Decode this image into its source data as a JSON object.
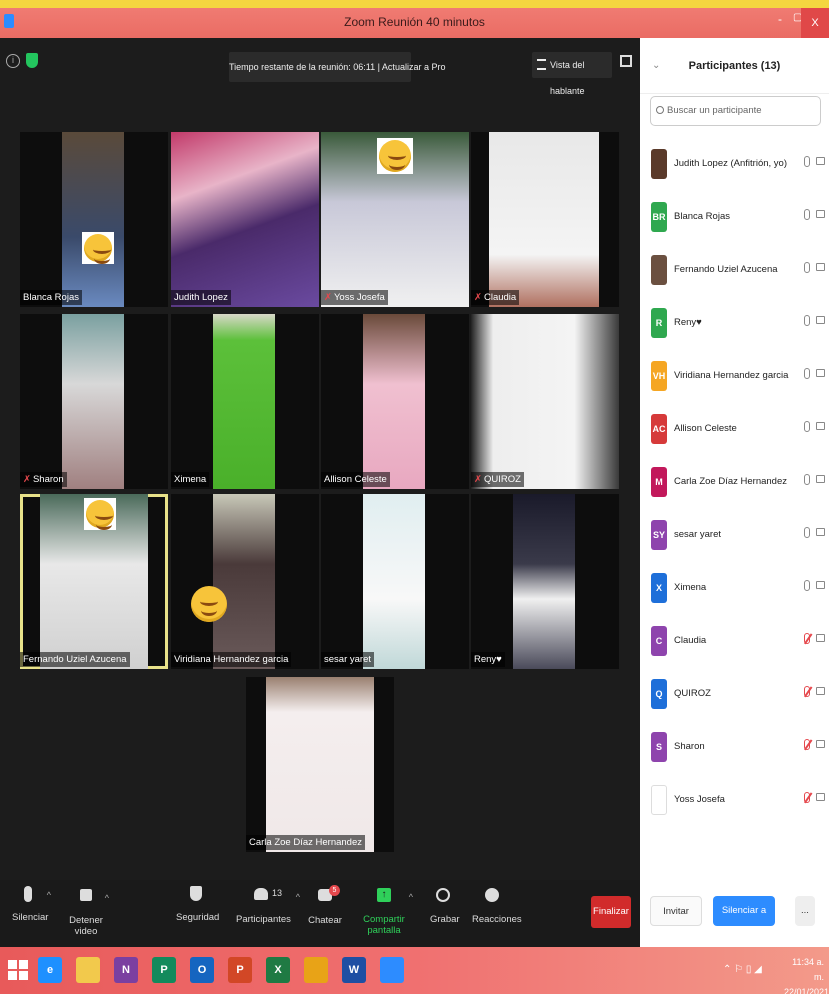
{
  "window": {
    "title": "Zoom Reunión 40 minutos",
    "minimize": "-",
    "maximize": "▢",
    "close": "X"
  },
  "meeting": {
    "time_banner": "Tiempo restante de la reunión: 06:11 | Actualizar a Pro",
    "speaker_view": "Vista del hablante",
    "info_symbol": "i"
  },
  "tiles": [
    {
      "name": "Blanca Rojas",
      "muted": false
    },
    {
      "name": "Judith Lopez",
      "muted": false
    },
    {
      "name": "Yoss Josefa",
      "muted": true
    },
    {
      "name": "Claudia",
      "muted": true
    },
    {
      "name": "Sharon",
      "muted": true
    },
    {
      "name": "Ximena",
      "muted": false
    },
    {
      "name": "Allison Celeste",
      "muted": false
    },
    {
      "name": "QUIROZ",
      "muted": true
    },
    {
      "name": "Fernando Uziel Azucena",
      "muted": false
    },
    {
      "name": "Viridiana Hernandez garcia",
      "muted": false
    },
    {
      "name": "sesar yaret",
      "muted": false
    },
    {
      "name": "Reny♥",
      "muted": false
    },
    {
      "name": "Carla Zoe Díaz Hernandez",
      "muted": false
    }
  ],
  "toolbar": {
    "mute": "Silenciar",
    "stop_video": "Detener video",
    "security": "Seguridad",
    "participants": "Participantes",
    "participants_count": "13",
    "chat": "Chatear",
    "chat_badge": "5",
    "share_screen": "Compartir pantalla",
    "record": "Grabar",
    "reactions": "Reacciones",
    "end": "Finalizar"
  },
  "panel": {
    "title": "Participantes (13)",
    "search_placeholder": "Buscar un participante",
    "participants": [
      {
        "name": "Judith Lopez (Anfitrión, yo)",
        "initials": "",
        "color": "#5a3a2a",
        "mic_off": false
      },
      {
        "name": "Blanca Rojas",
        "initials": "BR",
        "color": "#2fa84f",
        "mic_off": false
      },
      {
        "name": "Fernando Uziel Azucena",
        "initials": "",
        "color": "#6b5040",
        "mic_off": false
      },
      {
        "name": "Reny♥",
        "initials": "R",
        "color": "#2fa84f",
        "mic_off": false
      },
      {
        "name": "Viridiana Hernandez garcia",
        "initials": "VH",
        "color": "#f5a623",
        "mic_off": false
      },
      {
        "name": "Allison Celeste",
        "initials": "AC",
        "color": "#d63a3a",
        "mic_off": false
      },
      {
        "name": "Carla Zoe Díaz Hernandez",
        "initials": "M",
        "color": "#c2185b",
        "mic_off": false
      },
      {
        "name": "sesar yaret",
        "initials": "SY",
        "color": "#8e44ad",
        "mic_off": false
      },
      {
        "name": "Ximena",
        "initials": "X",
        "color": "#1e6fd9",
        "mic_off": false
      },
      {
        "name": "Claudia",
        "initials": "C",
        "color": "#8e44ad",
        "mic_off": true
      },
      {
        "name": "QUIROZ",
        "initials": "Q",
        "color": "#1e6fd9",
        "mic_off": true
      },
      {
        "name": "Sharon",
        "initials": "S",
        "color": "#8e44ad",
        "mic_off": true
      },
      {
        "name": "Yoss Josefa",
        "initials": "",
        "color": "#ffffff",
        "mic_off": true
      }
    ],
    "invite": "Invitar",
    "mute_all": "Silenciar a todos",
    "more": "..."
  },
  "taskbar": {
    "apps": [
      {
        "icon": "internet-explorer-icon",
        "letter": "e",
        "color": "#1e90ff"
      },
      {
        "icon": "file-explorer-icon",
        "letter": "",
        "color": "#f2c94c"
      },
      {
        "icon": "onenote-icon",
        "letter": "N",
        "color": "#7b3fa0"
      },
      {
        "icon": "publisher-icon",
        "letter": "P",
        "color": "#138a5c"
      },
      {
        "icon": "outlook-icon",
        "letter": "O",
        "color": "#1565c0"
      },
      {
        "icon": "powerpoint-icon",
        "letter": "P",
        "color": "#d24726"
      },
      {
        "icon": "excel-icon",
        "letter": "X",
        "color": "#1f7a43"
      },
      {
        "icon": "chrome-icon",
        "letter": "",
        "color": "#e8a317"
      },
      {
        "icon": "word-icon",
        "letter": "W",
        "color": "#1e4fa3"
      },
      {
        "icon": "zoom-icon",
        "letter": "",
        "color": "#2d8cff"
      }
    ],
    "time": "11:34 a. m.",
    "date": "22/01/2021"
  }
}
